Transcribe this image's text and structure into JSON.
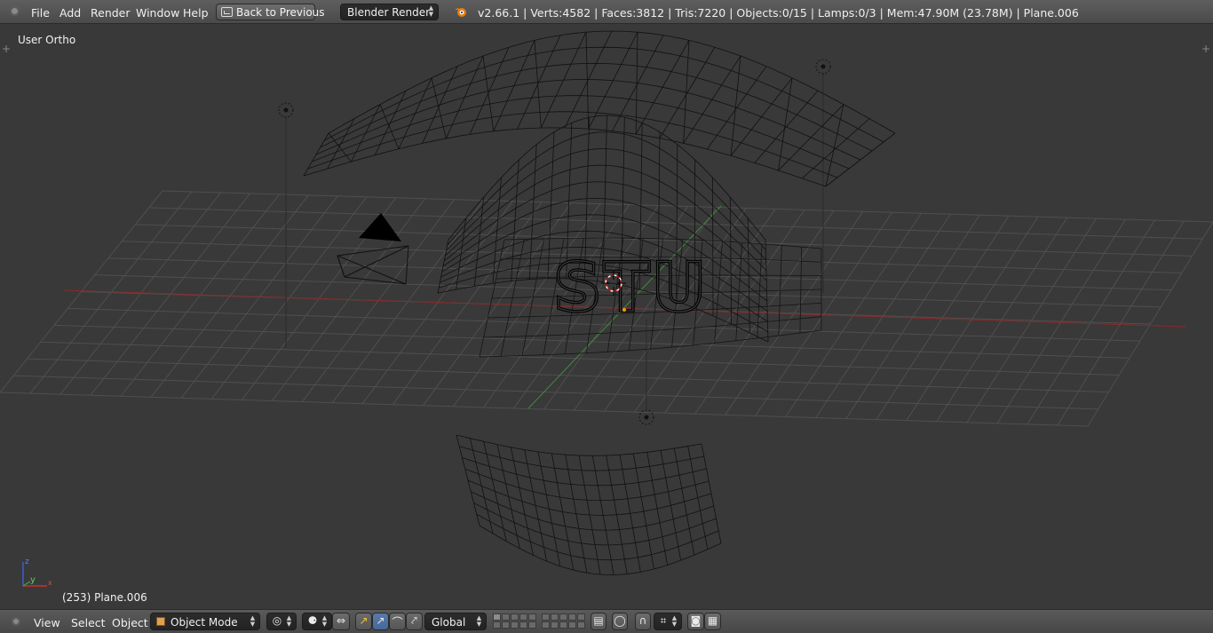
{
  "top_header": {
    "menu": [
      "File",
      "Add",
      "Render",
      "Window",
      "Help"
    ],
    "back_button": "Back to Previous",
    "render_engine": "Blender Render",
    "stats": "v2.66.1 | Verts:4582 | Faces:3812 | Tris:7220 | Objects:0/15 | Lamps:0/3 | Mem:47.90M (23.78M) | Plane.006"
  },
  "viewport": {
    "view_name": "User Ortho",
    "object_info": "(253) Plane.006",
    "mesh_text": "STU",
    "axes": {
      "z": "z",
      "y": "y",
      "x": "x"
    },
    "colors": {
      "background": "#393939",
      "grid": "#4e4e4e",
      "x_axis": "#8a2a2a",
      "y_axis": "#3f8a3f",
      "wire": "#000000"
    }
  },
  "bottom_header": {
    "menu": [
      "View",
      "Select",
      "Object"
    ],
    "mode": "Object Mode",
    "orientation": "Global",
    "icons": [
      "viewport-shading-icon",
      "pivot-point-icon",
      "manipulator-icon",
      "translate-icon",
      "rotate-icon",
      "scale-icon",
      "layers-icon",
      "lock-camera-icon",
      "proportional-edit-icon",
      "snap-icon",
      "render-icon",
      "render-animation-icon"
    ]
  }
}
